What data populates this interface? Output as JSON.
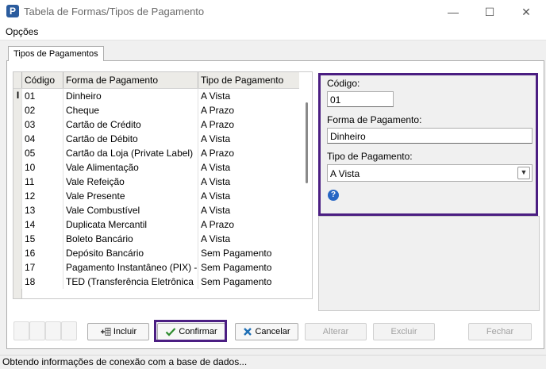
{
  "window": {
    "title": "Tabela de Formas/Tipos de Pagamento",
    "app_icon_letter": "P",
    "minimize_glyph": "—",
    "maximize_glyph": "☐",
    "close_glyph": "✕"
  },
  "menu": {
    "items": [
      "Opções"
    ]
  },
  "tab": {
    "label": "Tipos de Pagamentos"
  },
  "grid": {
    "columns": [
      "Código",
      "Forma de Pagamento",
      "Tipo de Pagamento"
    ],
    "current_row_marker": "I",
    "rows": [
      [
        "01",
        "Dinheiro",
        "A Vista"
      ],
      [
        "02",
        "Cheque",
        "A Prazo"
      ],
      [
        "03",
        "Cartão de Crédito",
        "A Prazo"
      ],
      [
        "04",
        "Cartão de Débito",
        "A Vista"
      ],
      [
        "05",
        "Cartão da Loja (Private Label)",
        "A Prazo"
      ],
      [
        "10",
        "Vale Alimentação",
        "A Vista"
      ],
      [
        "11",
        "Vale Refeição",
        "A Vista"
      ],
      [
        "12",
        "Vale Presente",
        "A Vista"
      ],
      [
        "13",
        "Vale Combustível",
        "A Vista"
      ],
      [
        "14",
        "Duplicata Mercantil",
        "A Prazo"
      ],
      [
        "15",
        "Boleto Bancário",
        "A Vista"
      ],
      [
        "16",
        "Depósito Bancário",
        "Sem Pagamento"
      ],
      [
        "17",
        "Pagamento Instantâneo (PIX) - ",
        "Sem Pagamento"
      ],
      [
        "18",
        "TED (Transferência Eletrônica",
        "Sem Pagamento"
      ]
    ]
  },
  "form": {
    "codigo_label": "Código:",
    "codigo_value": "01",
    "forma_label": "Forma de Pagamento:",
    "forma_value": "Dinheiro",
    "tipo_label": "Tipo de Pagamento:",
    "tipo_value": "A Vista",
    "help_glyph": "?"
  },
  "buttons": {
    "incluir": "Incluir",
    "confirmar": "Confirmar",
    "cancelar": "Cancelar",
    "alterar": "Alterar",
    "excluir": "Excluir",
    "fechar": "Fechar"
  },
  "status": {
    "text": "Obtendo informações de conexão com a base de dados..."
  },
  "colors": {
    "highlight_border": "#4b1e82",
    "confirm_check": "#2e8b2e",
    "cancel_x": "#1f6fb5"
  }
}
